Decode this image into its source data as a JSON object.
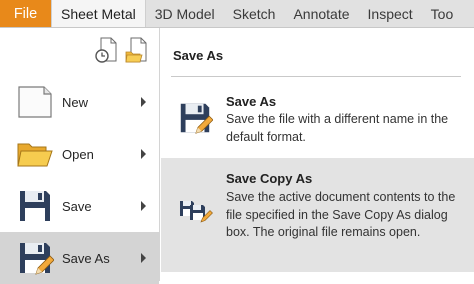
{
  "ribbon": {
    "tabs": [
      {
        "label": "File"
      },
      {
        "label": "Sheet Metal"
      },
      {
        "label": "3D Model"
      },
      {
        "label": "Sketch"
      },
      {
        "label": "Annotate"
      },
      {
        "label": "Inspect"
      },
      {
        "label": "Too"
      }
    ],
    "active_tab": "Sheet Metal",
    "file_tab_color": "#e8891a"
  },
  "file_menu": {
    "recent_icons": [
      "recent-documents-icon",
      "open-folder-icon"
    ],
    "items": [
      {
        "label": "New",
        "icon": "new-document-icon",
        "has_submenu": true
      },
      {
        "label": "Open",
        "icon": "open-folder-icon",
        "has_submenu": true
      },
      {
        "label": "Save",
        "icon": "save-floppy-icon",
        "has_submenu": true
      },
      {
        "label": "Save As",
        "icon": "save-as-icon",
        "has_submenu": true,
        "selected": true
      }
    ]
  },
  "submenu": {
    "title": "Save As",
    "options": [
      {
        "title": "Save As",
        "description": "Save the file with a different name in the default format.",
        "icon": "save-as-icon"
      },
      {
        "title": "Save Copy As",
        "description": "Save the active document contents to the file specified in the Save Copy As dialog box. The original file remains open.",
        "icon": "save-copy-as-icon",
        "hovered": true
      }
    ]
  },
  "colors": {
    "accent": "#e8891a",
    "selected_bg": "#d4d4d4",
    "hover_bg": "#e3e3e3",
    "floppy_blue": "#2e3f5c"
  }
}
